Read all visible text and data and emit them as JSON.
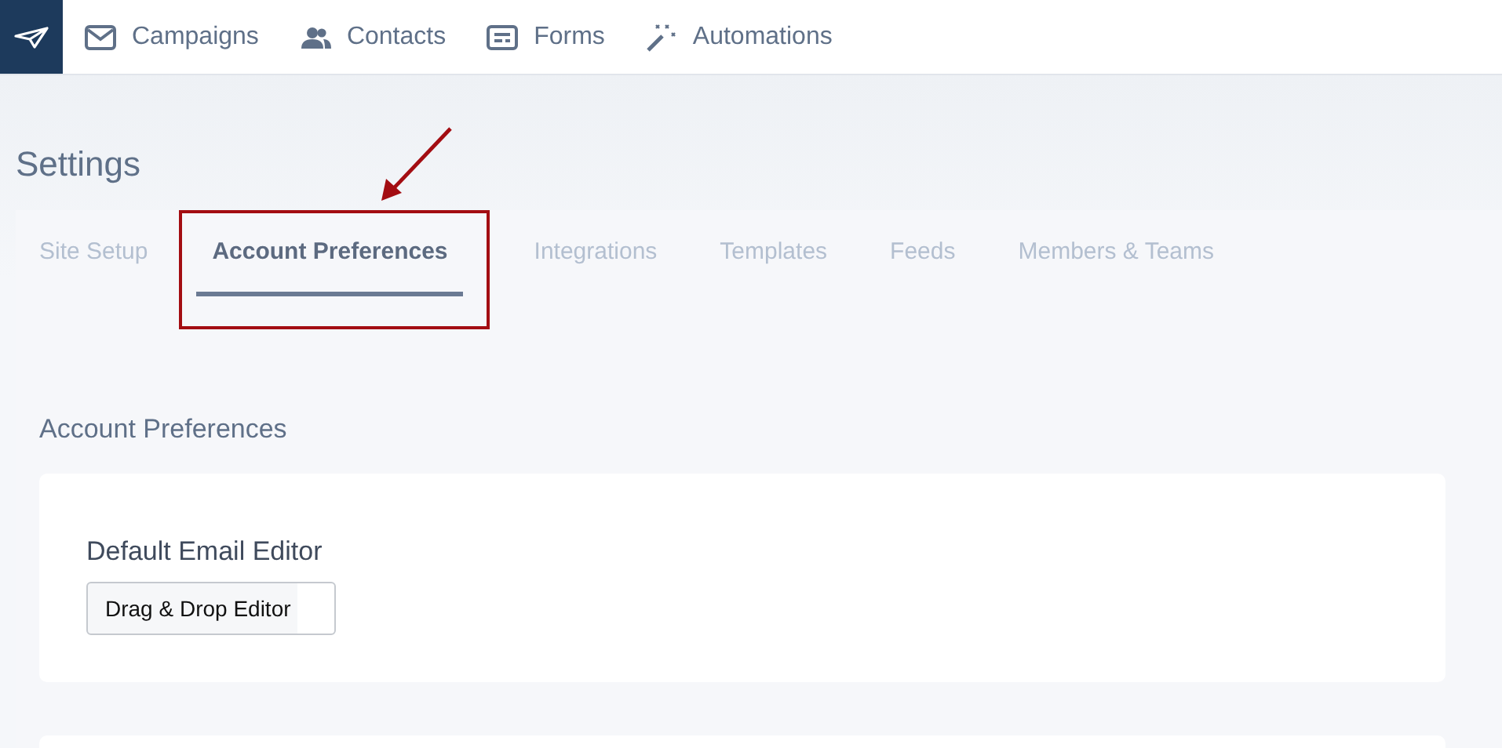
{
  "nav": {
    "items": [
      {
        "label": "Campaigns"
      },
      {
        "label": "Contacts"
      },
      {
        "label": "Forms"
      },
      {
        "label": "Automations"
      }
    ]
  },
  "page": {
    "title": "Settings"
  },
  "tabs": [
    {
      "label": "Site Setup",
      "selected": false,
      "highlighted": false
    },
    {
      "label": "Account Preferences",
      "selected": true,
      "highlighted": true
    },
    {
      "label": "Integrations",
      "selected": false,
      "highlighted": false
    },
    {
      "label": "Templates",
      "selected": false,
      "highlighted": false
    },
    {
      "label": "Feeds",
      "selected": false,
      "highlighted": false
    },
    {
      "label": "Members & Teams",
      "selected": false,
      "highlighted": false
    }
  ],
  "section": {
    "title": "Account Preferences",
    "field_label": "Default Email Editor",
    "field_value": "Drag & Drop Editor"
  }
}
